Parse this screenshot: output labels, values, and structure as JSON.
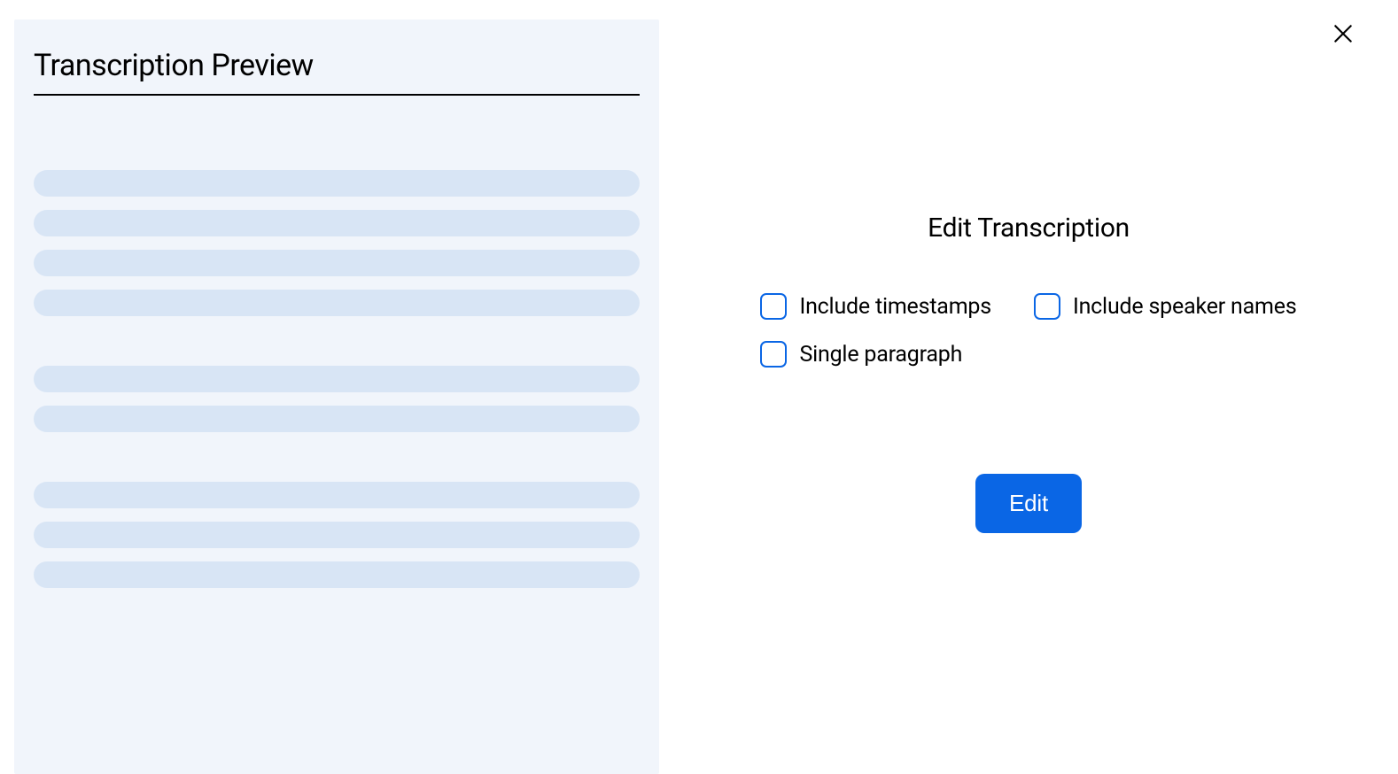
{
  "preview": {
    "title": "Transcription Preview"
  },
  "edit": {
    "title": "Edit Transcription",
    "options": {
      "timestamps": "Include timestamps",
      "speaker_names": "Include speaker names",
      "single_paragraph": "Single paragraph"
    },
    "button_label": "Edit"
  }
}
